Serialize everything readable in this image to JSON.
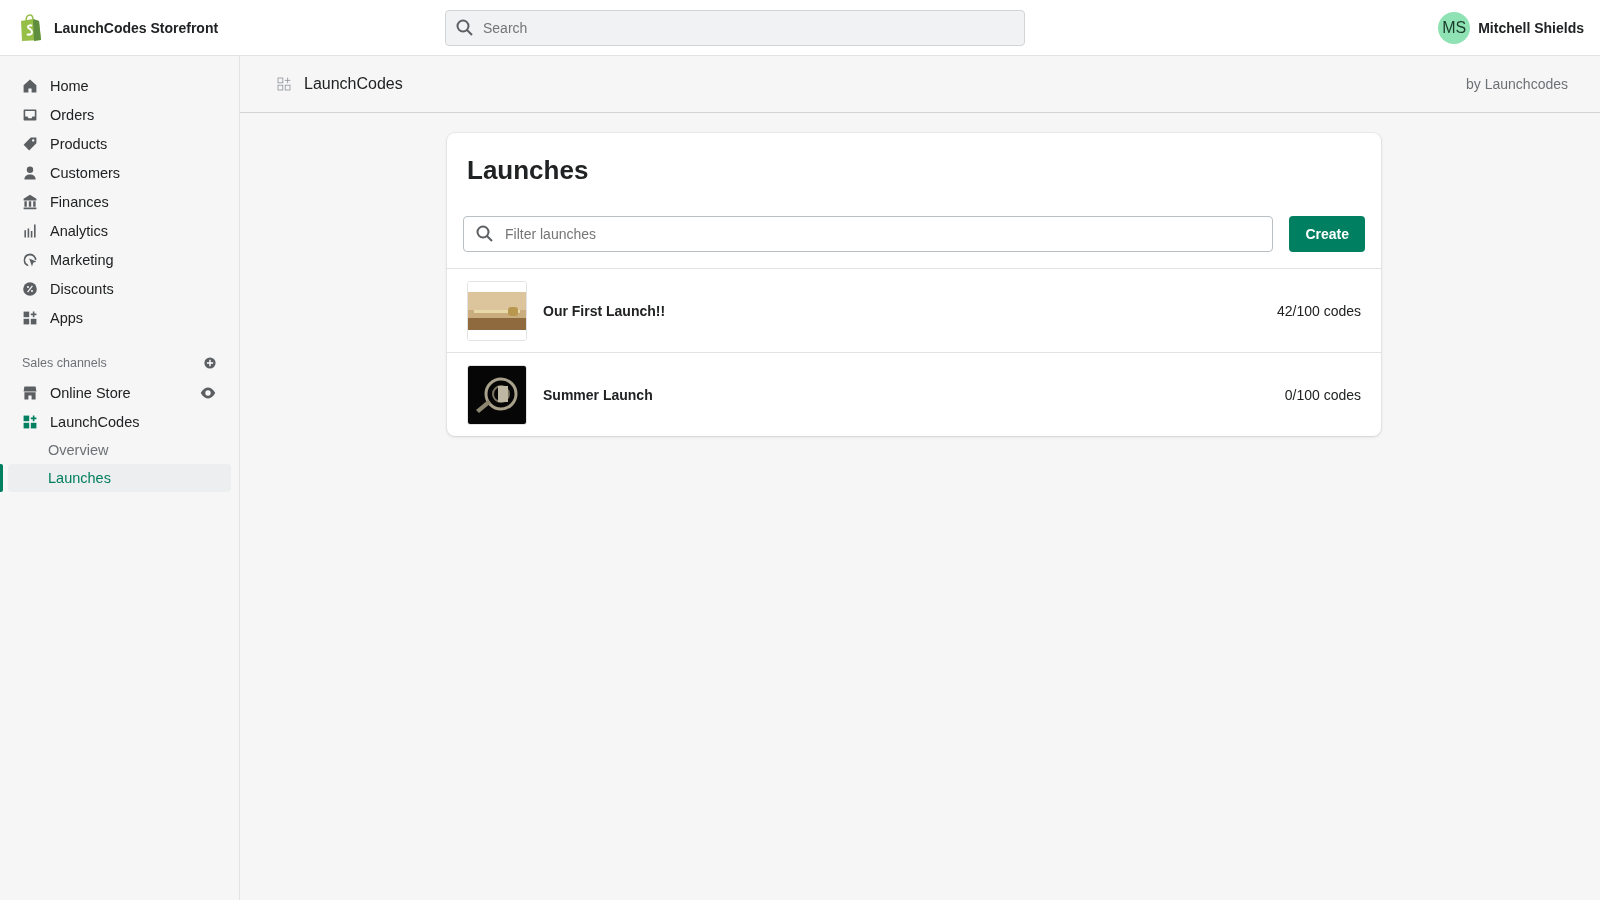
{
  "topbar": {
    "store_name": "LaunchCodes Storefront",
    "search": {
      "placeholder": "Search"
    },
    "user": {
      "initials": "MS",
      "name": "Mitchell Shields"
    }
  },
  "sidebar": {
    "items": [
      {
        "label": "Home",
        "selected": false
      },
      {
        "label": "Orders",
        "selected": false
      },
      {
        "label": "Products",
        "selected": false
      },
      {
        "label": "Customers",
        "selected": false
      },
      {
        "label": "Finances",
        "selected": false
      },
      {
        "label": "Analytics",
        "selected": false
      },
      {
        "label": "Marketing",
        "selected": false
      },
      {
        "label": "Discounts",
        "selected": false
      },
      {
        "label": "Apps",
        "selected": false
      }
    ],
    "section_title": "Sales channels",
    "channels": [
      {
        "label": "Online Store",
        "selected": false
      },
      {
        "label": "LaunchCodes",
        "selected": false,
        "children": [
          {
            "label": "Overview",
            "selected": false
          },
          {
            "label": "Launches",
            "selected": true
          }
        ]
      }
    ]
  },
  "app_bar": {
    "title": "LaunchCodes",
    "byline": "by Launchcodes"
  },
  "card": {
    "title": "Launches",
    "filter": {
      "placeholder": "Filter launches"
    },
    "create_button": "Create",
    "rows": [
      {
        "name": "Our First Launch!!",
        "codes": "42/100 codes",
        "kind": "picture"
      },
      {
        "name": "Summer Launch",
        "codes": "0/100 codes",
        "kind": "picture"
      }
    ]
  }
}
